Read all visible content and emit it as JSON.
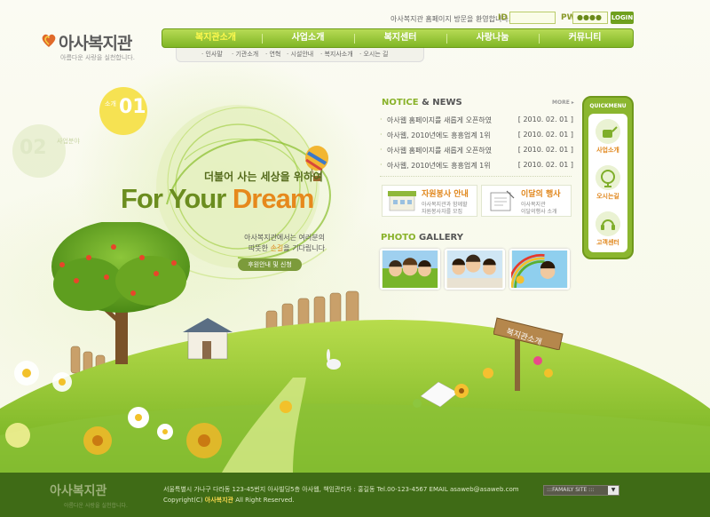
{
  "brand": {
    "name": "아사복지관",
    "tagline": "아름다운 사랑을 실천합니다."
  },
  "login": {
    "welcome": "아사복지관 홈페이지 방문을 환영합니다.",
    "id_label": "ID",
    "id_value": "",
    "pw_label": "PW",
    "pw_value": "●●●●",
    "button": "LOGIN"
  },
  "nav": {
    "items": [
      "복지관소개",
      "사업소개",
      "복지센터",
      "사랑나눔",
      "커뮤니티"
    ],
    "active_index": 0,
    "subitems": [
      "· 인사말",
      "· 기관소개",
      "· 연혁",
      "· 시설안내",
      "· 복지사소개",
      "· 오시는 길"
    ]
  },
  "hero": {
    "badge1_label": "소개",
    "badge1_number": "01",
    "badge2_number": "02",
    "badge2_label": "사업분야",
    "subtitle": "더불어 사는 세상을 위하여",
    "title_a": "For Your ",
    "title_b": "Dream",
    "desc_line1": "아사복지관에서는 여러분의",
    "desc_line2_a": "따뜻한 ",
    "desc_line2_hl": "손길",
    "desc_line2_b": "을 기다립니다",
    "button": "후원안내 및 신청"
  },
  "notice": {
    "title_a": "NOTICE",
    "title_b": " & NEWS",
    "more": "MORE ▸",
    "items": [
      {
        "text": "아사웹 홈페이지를 새롭게 오픈하였",
        "date": "[ 2010. 02. 01 ]"
      },
      {
        "text": "아사웹, 2010년에도 흥흥업계 1위",
        "date": "[ 2010. 02. 01 ]"
      },
      {
        "text": "아사웹 홈페이지를 새롭게 오픈하였",
        "date": "[ 2010. 02. 01 ]"
      },
      {
        "text": "아사웹, 2010년에도 흥흥업계 1위",
        "date": "[ 2010. 02. 01 ]"
      }
    ]
  },
  "banners": {
    "volunteer": {
      "title": "자원봉사 안내",
      "line1": "아사복지관과 함께할",
      "line2": "자원봉사자를 모집"
    },
    "event": {
      "title": "이달의 행사",
      "line1": "아사복지관",
      "line2": "이달의행사 소개"
    }
  },
  "gallery": {
    "title_a": "PHOTO",
    "title_b": " GALLERY"
  },
  "quick": {
    "header": "QUICKMENU",
    "items": [
      "사업소개",
      "오시는길",
      "고객센터"
    ]
  },
  "sign_text": "복지관소개",
  "footer": {
    "logo": "아사복지관",
    "logo_sub": "아름다운 사랑을 실천합니다.",
    "address": "서울특별시 가나구 다라동 123-45번지 아사빌딩5층 아사웹, 책임관리자 : 홍길동  Tel.00-123-4567  EMAIL asaweb@asaweb.com",
    "copy_a": "Copyright(C) ",
    "copy_hl": "아사복지관",
    "copy_b": " All Right Reserved.",
    "family_site": ":::FAMAILY SITE :::",
    "family_arrow": "▼"
  },
  "colors": {
    "nav_green": "#8bbb2c",
    "accent_orange": "#e0861b",
    "footer_green": "#3f6b16",
    "title_green": "#6b8d1f"
  }
}
